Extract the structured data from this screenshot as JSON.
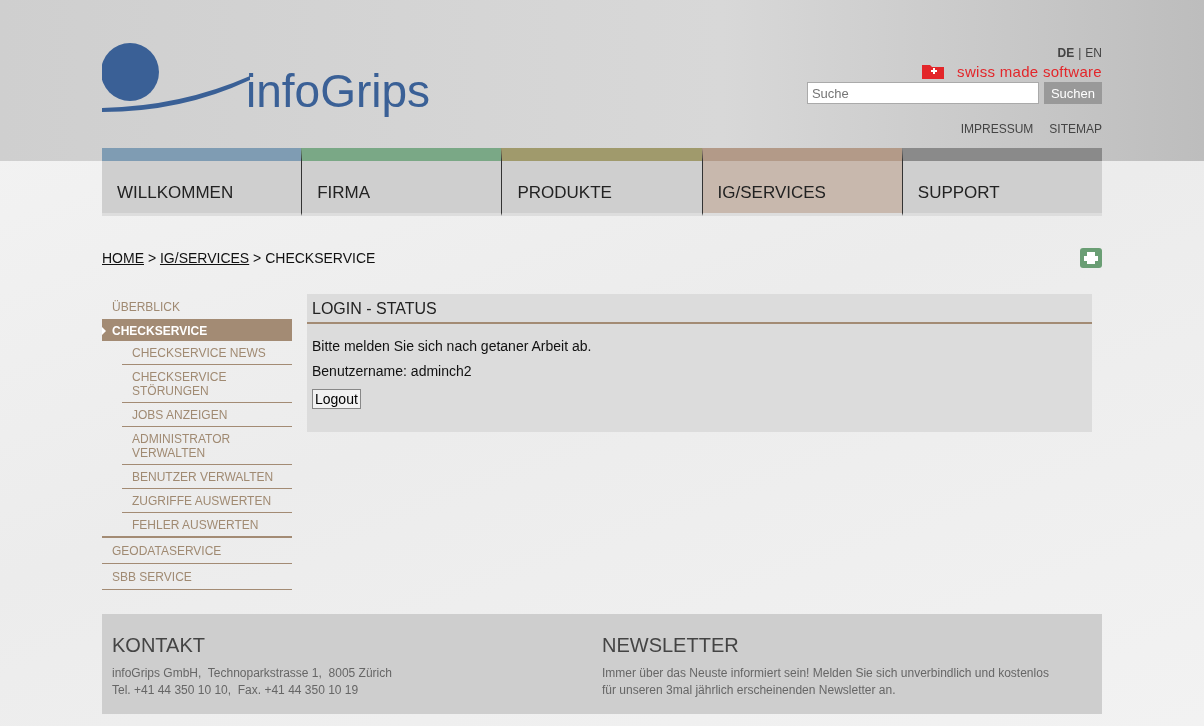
{
  "header": {
    "logo_text": "infoGrips",
    "languages": [
      {
        "label": "DE",
        "selected": true
      },
      {
        "label": "EN",
        "selected": false
      }
    ],
    "language_separator": "|",
    "badge_text": "swiss made software",
    "search": {
      "placeholder": "Suche",
      "button": "Suchen"
    },
    "links": [
      "IMPRESSUM",
      "SITEMAP"
    ]
  },
  "nav": [
    {
      "label": "WILLKOMMEN",
      "color": "#7f9cb3",
      "selected": false
    },
    {
      "label": "FIRMA",
      "color": "#7aa886",
      "selected": false
    },
    {
      "label": "PRODUKTE",
      "color": "#a09a6c",
      "selected": false
    },
    {
      "label": "IG/SERVICES",
      "color": "#b39a88",
      "selected": true
    },
    {
      "label": "SUPPORT",
      "color": "#8a8a8a",
      "selected": false
    }
  ],
  "breadcrumb_separator": ">",
  "breadcrumb": [
    {
      "label": "HOME",
      "link": true
    },
    {
      "label": "IG/SERVICES",
      "link": true
    },
    {
      "label": "CHECKSERVICE",
      "link": false
    }
  ],
  "sidebar": [
    {
      "label": "ÜBERBLICK",
      "selected": false
    },
    {
      "label": "CHECKSERVICE",
      "selected": true,
      "children": [
        {
          "label": "CHECKSERVICE NEWS",
          "selected": false
        },
        {
          "label": "CHECKSERVICE STÖRUNGEN",
          "selected": false
        },
        {
          "label": "JOBS ANZEIGEN",
          "selected": false
        },
        {
          "label": "ADMINISTRATOR VERWALTEN",
          "selected": false
        },
        {
          "label": "BENUTZER VERWALTEN",
          "selected": false
        },
        {
          "label": "ZUGRIFFE AUSWERTEN",
          "selected": false
        },
        {
          "label": "FEHLER AUSWERTEN",
          "selected": false
        }
      ]
    },
    {
      "label": "GEODATASERVICE",
      "selected": false
    },
    {
      "label": "SBB SERVICE",
      "selected": false
    }
  ],
  "panel": {
    "title": "LOGIN - STATUS",
    "message": "Bitte melden Sie sich nach getaner Arbeit ab.",
    "username_label": "Benutzername:",
    "username": "adminch2",
    "button": "Logout"
  },
  "footer": [
    {
      "title": "KONTAKT",
      "lines": [
        "infoGrips GmbH,  Technoparkstrasse 1,  8005 Zürich",
        "Tel. +41 44 350 10 10,  Fax. +41 44 350 10 19"
      ]
    },
    {
      "title": "NEWSLETTER",
      "lines": [
        "Immer über das Neuste informiert sein! Melden Sie sich unverbindlich und kostenlos",
        "für unseren 3mal jährlich erscheinenden Newsletter an."
      ]
    }
  ]
}
